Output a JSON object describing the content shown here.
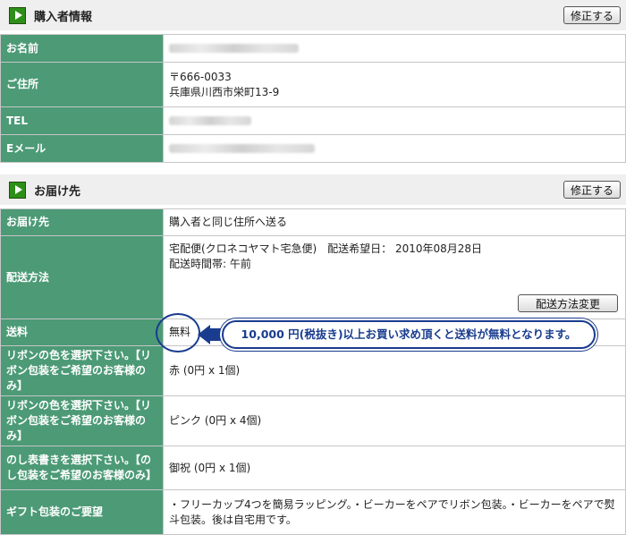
{
  "buyer": {
    "title": "購入者情報",
    "edit_label": "修正する",
    "rows": {
      "name_label": "お名前",
      "address_label": "ご住所",
      "postal": "〒666-0033",
      "address": "兵庫県川西市栄町13-9",
      "tel_label": "TEL",
      "email_label": "Eメール"
    }
  },
  "delivery": {
    "title": "お届け先",
    "edit_label": "修正する",
    "dest_label": "お届け先",
    "dest_value": "購入者と同じ住所へ送る",
    "method_label": "配送方法",
    "method_line1": "宅配便(クロネコヤマト宅急便)　配送希望日： 2010年08月28日",
    "method_line2": "配送時間帯: 午前",
    "method_change_label": "配送方法変更",
    "shipping_label": "送料",
    "shipping_value": "無料",
    "ribbon1_label": "リボンの色を選択下さい。【リボン包装をご希望のお客様のみ】",
    "ribbon1_value": "赤 (0円 x 1個)",
    "ribbon2_label": "リボンの色を選択下さい。【リボン包装をご希望のお客様のみ】",
    "ribbon2_value": "ピンク (0円 x 4個)",
    "noshi_label": "のし表書きを選択下さい。【のし包装をご希望のお客様のみ】",
    "noshi_value": "御祝 (0円 x 1個)",
    "gift_label": "ギフト包装のご要望",
    "gift_value": "・フリーカップ4つを簡易ラッピング。・ビーカーをペアでリボン包装。・ビーカーをペアで熨斗包装。後は自宅用です。"
  },
  "callout": {
    "text": "10,000 円(税抜き)以上お買い求め頂くと送料が無料となります。"
  },
  "colors": {
    "label_bg": "#4c9a76",
    "header_bg": "#efefef",
    "play_icon": "#2d8f17",
    "callout": "#1a3c8f"
  }
}
